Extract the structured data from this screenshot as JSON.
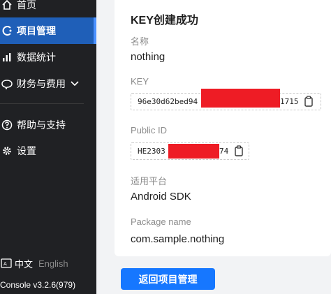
{
  "sidebar": {
    "items": [
      {
        "label": "首页",
        "icon": "home-icon"
      },
      {
        "label": "项目管理",
        "icon": "project-icon",
        "active": true
      },
      {
        "label": "数据统计",
        "icon": "bar-chart-icon"
      },
      {
        "label": "财务与费用",
        "icon": "finance-icon"
      },
      {
        "label": "帮助与支持",
        "icon": "help-icon"
      },
      {
        "label": "设置",
        "icon": "gear-icon"
      }
    ],
    "lang_cn": "中文",
    "lang_en": "English",
    "version": "Console v3.2.6(979)"
  },
  "card": {
    "title": "KEY创建成功",
    "name_label": "名称",
    "name_value": "nothing",
    "key_label": "KEY",
    "key_prefix": "96e30d62bed94",
    "key_suffix": "1715",
    "pid_label": "Public ID",
    "pid_prefix": "HE2303",
    "pid_suffix": "74",
    "platform_label": "适用平台",
    "platform_value": "Android SDK",
    "package_label": "Package name",
    "package_value": "com.sample.nothing"
  },
  "back_button": "返回项目管理",
  "colors": {
    "sidebar_bg": "#202124",
    "active_bg": "#1f5fb8",
    "primary": "#1677ff",
    "redaction": "#ee1c25"
  }
}
